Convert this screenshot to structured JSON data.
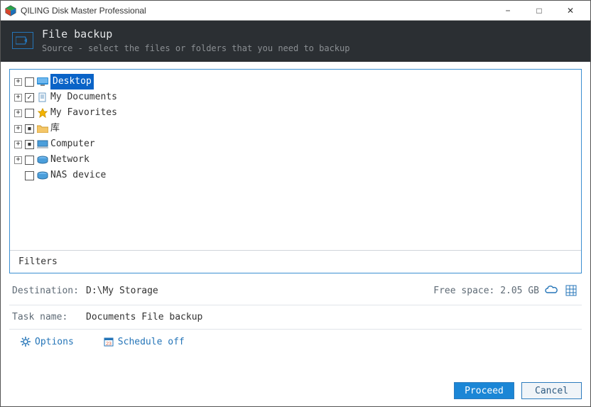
{
  "window": {
    "title": "QILING Disk Master Professional"
  },
  "header": {
    "title": "File backup",
    "subtitle": "Source - select the files or folders that you need to backup"
  },
  "tree": {
    "items": [
      {
        "label": "Desktop",
        "selected": true,
        "checked": "unchecked",
        "expandable": true,
        "icon": "desktop"
      },
      {
        "label": "My Documents",
        "selected": false,
        "checked": "checked",
        "expandable": true,
        "icon": "documents"
      },
      {
        "label": "My Favorites",
        "selected": false,
        "checked": "unchecked",
        "expandable": true,
        "icon": "star"
      },
      {
        "label": "库",
        "selected": false,
        "checked": "indet",
        "expandable": true,
        "icon": "folder"
      },
      {
        "label": "Computer",
        "selected": false,
        "checked": "indet",
        "expandable": true,
        "icon": "computer"
      },
      {
        "label": "Network",
        "selected": false,
        "checked": "unchecked",
        "expandable": true,
        "icon": "network"
      },
      {
        "label": "NAS device",
        "selected": false,
        "checked": "unchecked",
        "expandable": false,
        "icon": "nas"
      }
    ],
    "filters_label": "Filters"
  },
  "destination": {
    "label": "Destination:",
    "value": "D:\\My Storage",
    "free_space_label": "Free space: 2.05 GB"
  },
  "task": {
    "label": "Task name:",
    "value": "Documents File backup"
  },
  "toolbar": {
    "options_label": "Options",
    "schedule_label": "Schedule off"
  },
  "footer": {
    "proceed": "Proceed",
    "cancel": "Cancel"
  }
}
